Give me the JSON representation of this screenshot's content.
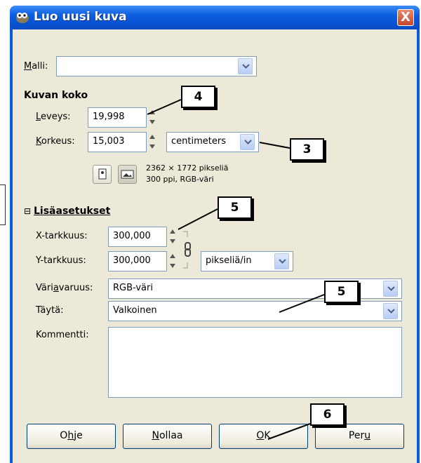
{
  "window": {
    "title": "Luo uusi kuva",
    "close_label": "X"
  },
  "template": {
    "label": "Malli:",
    "value": ""
  },
  "image_size": {
    "heading": "Kuvan koko",
    "width_label": "Leveys:",
    "width_value": "19,998",
    "height_label": "Korkeus:",
    "height_value": "15,003",
    "unit": "centimeters",
    "info_line1": "2362 × 1772 pikseliä",
    "info_line2": "300 ppi, RGB-väri"
  },
  "advanced": {
    "heading": "Lisäasetukset",
    "toggle": "⊟",
    "xres_label": "X-tarkkuus:",
    "xres_value": "300,000",
    "yres_label": "Y-tarkkuus:",
    "yres_value": "300,000",
    "res_unit": "pikseliä/in",
    "colorspace_label": "Väriavaruus:",
    "colorspace_value": "RGB-väri",
    "fill_label": "Täytä:",
    "fill_value": "Valkoinen",
    "comment_label": "Kommentti:",
    "comment_value": ""
  },
  "buttons": {
    "help": "Ohje",
    "reset": "Nollaa",
    "ok": "OK",
    "cancel": "Peru"
  },
  "callouts": {
    "width": "4",
    "unit": "3",
    "resolution": "5",
    "fill": "5",
    "ok": "6"
  },
  "colors": {
    "titlebar": "#0a5fd8",
    "dialog_bg": "#ece9d8",
    "close": "#d5502f"
  }
}
